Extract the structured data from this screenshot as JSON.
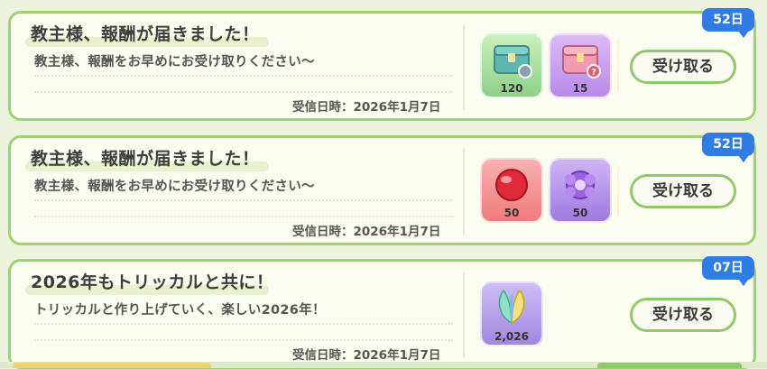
{
  "mails": [
    {
      "title": "教主様、報酬が届きました！",
      "body": "教主様、報酬をお早めにお受け取りください～",
      "date": "受信日時：2026年1月7日",
      "days_left": "52日",
      "claim_label": "受け取る",
      "rewards": [
        {
          "icon": "teal-treasure-box-icon",
          "qty": "120",
          "color": "#a7e6a3"
        },
        {
          "icon": "pink-treasure-box-icon",
          "qty": "15",
          "color": "#c9a2f0"
        },
        {
          "icon": "gold-coin-icon",
          "qty": "",
          "color": "#f5d65c"
        }
      ]
    },
    {
      "title": "教主様、報酬が届きました！",
      "body": "教主様、報酬をお早めにお受け取りください～",
      "date": "受信日時：2026年1月7日",
      "days_left": "52日",
      "claim_label": "受け取る",
      "rewards": [
        {
          "icon": "red-orb-icon",
          "qty": "50",
          "color": "#f48a8a"
        },
        {
          "icon": "purple-crystal-icon",
          "qty": "50",
          "color": "#b58be8"
        },
        {
          "icon": "gold-coin-icon",
          "qty": "",
          "color": "#f5d65c"
        }
      ]
    },
    {
      "title": "2026年もトリッカルと共に！",
      "body": "トリッカルと作り上げていく、楽しい2026年！",
      "date": "受信日時：2026年1月7日",
      "days_left": "07日",
      "claim_label": "受け取る",
      "rewards": [
        {
          "icon": "rainbow-leaf-icon",
          "qty": "2,026",
          "color": "#b9a3f0"
        }
      ]
    }
  ]
}
